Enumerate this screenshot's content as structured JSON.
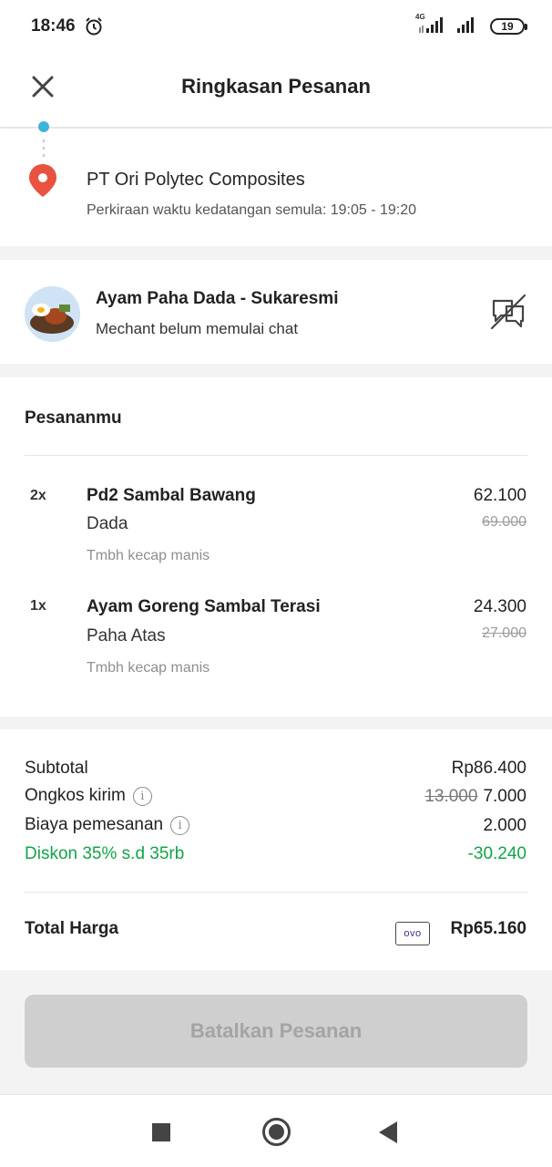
{
  "status_bar": {
    "time": "18:46",
    "network": "4G",
    "battery": "19"
  },
  "header": {
    "title": "Ringkasan Pesanan"
  },
  "destination": {
    "name": "PT Ori Polytec Composites",
    "eta": "Perkiraan waktu kedatangan semula: 19:05 - 19:20"
  },
  "merchant": {
    "name": "Ayam Paha Dada - Sukaresmi",
    "status": "Mechant belum memulai chat"
  },
  "order": {
    "title": "Pesananmu",
    "items": [
      {
        "qty": "2x",
        "name": "Pd2 Sambal Bawang",
        "variant": "Dada",
        "note": "Tmbh kecap manis",
        "price": "62.100",
        "original_price": "69.000"
      },
      {
        "qty": "1x",
        "name": "Ayam Goreng Sambal Terasi",
        "variant": "Paha Atas",
        "note": "Tmbh kecap manis",
        "price": "24.300",
        "original_price": "27.000"
      }
    ]
  },
  "summary": {
    "subtotal_label": "Subtotal",
    "subtotal_value": "Rp86.400",
    "delivery_label": "Ongkos kirim",
    "delivery_original": "13.000",
    "delivery_value": "7.000",
    "service_label": "Biaya pemesanan",
    "service_value": "2.000",
    "discount_label": "Diskon 35% s.d 35rb",
    "discount_value": "-30.240",
    "total_label": "Total Harga",
    "payment_method": "OVO",
    "total_value": "Rp65.160"
  },
  "actions": {
    "cancel_label": "Batalkan Pesanan"
  },
  "colors": {
    "accent_green": "#12a44a",
    "pin_red": "#e8523f",
    "route_blue": "#3eb4d9"
  }
}
